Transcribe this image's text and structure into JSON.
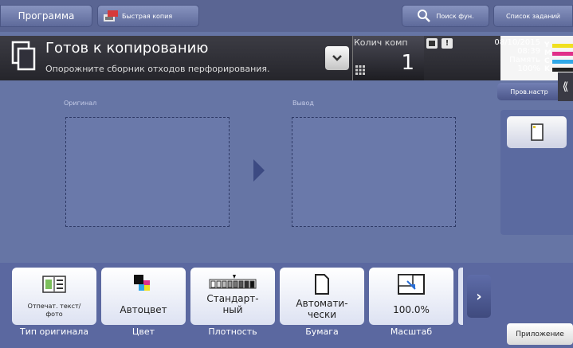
{
  "topbar": {
    "program": "Программа",
    "quick_copy": "Быстрая копия",
    "search_fn": "Поиск фун.",
    "job_list": "Список заданий"
  },
  "status": {
    "title": "Готов к копированию",
    "message": "Опорожните сборник отходов перфорирования.",
    "qty_label": "Колич комп",
    "qty_value": "1",
    "date": "08/10/2015",
    "time": "08:39",
    "memory_label": "Память",
    "memory_value": "100%",
    "toner": [
      {
        "letter": "Y",
        "color": "#f0e020"
      },
      {
        "letter": "M",
        "color": "#e0308a"
      },
      {
        "letter": "C",
        "color": "#30a8e8"
      },
      {
        "letter": "K",
        "color": "#222222"
      }
    ]
  },
  "preview": {
    "original_label": "Оригинал",
    "output_label": "Вывод"
  },
  "side": {
    "prov_button": "Пров.настр"
  },
  "functions": [
    {
      "icon": "text-photo-icon",
      "label": "Отпечат. текст/фото",
      "caption": "Тип оригинала"
    },
    {
      "icon": "color-icon",
      "label": "Автоцвет",
      "caption": "Цвет"
    },
    {
      "icon": "density-icon",
      "label": "Стандарт-ный",
      "caption": "Плотность"
    },
    {
      "icon": "paper-icon",
      "label": "Автомати-чески",
      "caption": "Бумага"
    },
    {
      "icon": "zoom-icon",
      "label": "100.0%",
      "caption": "Масштаб"
    }
  ],
  "app_button": "Приложение"
}
